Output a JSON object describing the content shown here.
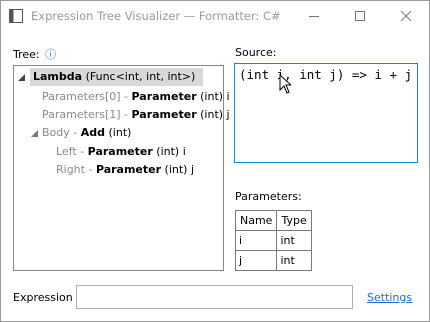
{
  "window": {
    "title": "Expression Tree Visualizer — Formatter: C#",
    "controls": {
      "minimize_icon": "minimize-icon",
      "maximize_icon": "maximize-icon",
      "close_icon": "close-icon"
    }
  },
  "tree": {
    "label": "Tree:",
    "info_glyph": "ⓘ",
    "nodes": [
      {
        "name": "Lambda",
        "detail": "(Func<int, int, int>)",
        "selected": true,
        "expanded": true
      },
      {
        "prefix": "Parameters[0] - ",
        "name": "Parameter",
        "detail": " (int) i"
      },
      {
        "prefix": "Parameters[1] - ",
        "name": "Parameter",
        "detail": " (int) j"
      },
      {
        "prefix": "Body - ",
        "name": "Add",
        "detail": " (int)",
        "expanded": true
      },
      {
        "prefix": "Left - ",
        "name": "Parameter",
        "detail": " (int) i"
      },
      {
        "prefix": "Right - ",
        "name": "Parameter",
        "detail": " (int) j"
      }
    ]
  },
  "source": {
    "label": "Source:",
    "code": "(int i, int j) => i + j"
  },
  "parameters": {
    "label": "Parameters:",
    "headers": [
      "Name",
      "Type"
    ],
    "rows": [
      [
        "i",
        "int"
      ],
      [
        "j",
        "int"
      ]
    ]
  },
  "expression": {
    "label": "Expression",
    "value": "",
    "placeholder": ""
  },
  "settings_link": "Settings",
  "colors": {
    "accent": "#1a6fd1",
    "selection": "#d9d9d9",
    "focus_border": "#1f86d6"
  }
}
